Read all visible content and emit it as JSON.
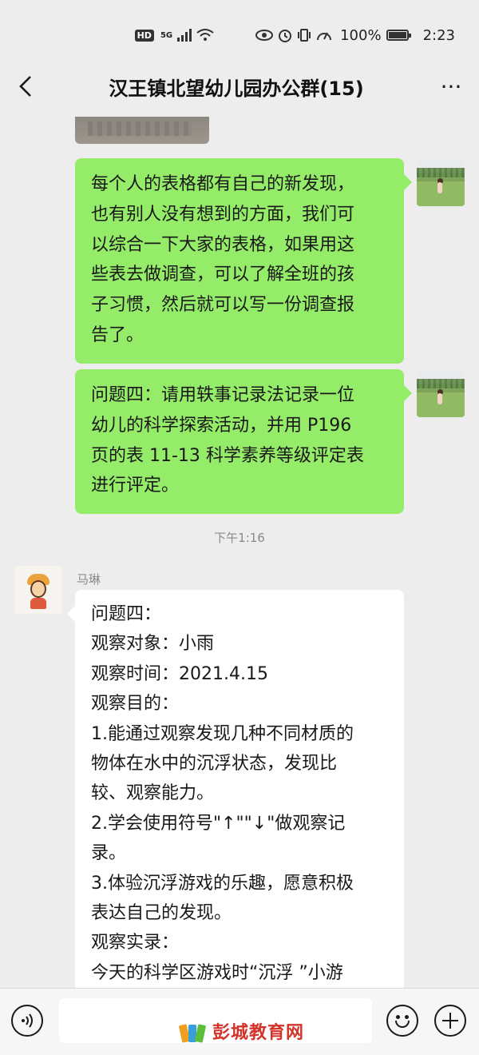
{
  "status_bar": {
    "hd": "HD",
    "network": "5G",
    "battery_pct": "100%",
    "battery_level": 1.0,
    "time": "2:23",
    "icons": [
      "signal-icon",
      "wifi-icon",
      "eye-icon",
      "alarm-icon",
      "vibrate-icon",
      "speed-icon",
      "battery-icon"
    ]
  },
  "nav": {
    "back_icon": "chevron-left-icon",
    "title": "汉王镇北望幼儿园办公群(15)",
    "more": "···"
  },
  "messages": [
    {
      "side": "right",
      "lines": [
        "每个人的表格都有自己的新发现，",
        "也有别人没有想到的方面，我们可",
        "以综合一下大家的表格，如果用这",
        "些表去做调查，可以了解全班的孩",
        "子习惯，然后就可以写一份调查报",
        "告了。"
      ]
    },
    {
      "side": "right",
      "lines": [
        "问题四：请用轶事记录法记录一位",
        "幼儿的科学探索活动，并用 P196",
        "页的表 11-13 科学素养等级评定表",
        "进行评定。"
      ]
    }
  ],
  "timestamp": "下午1:16",
  "incoming": {
    "sender": "马琳",
    "lines": [
      "问题四：",
      "观察对象：小雨",
      "观察时间：2021.4.15",
      "观察目的：",
      "1.能通过观察发现几种不同材质的",
      "物体在水中的沉浮状态，发现比",
      "较、观察能力。",
      "2.学会使用符号\"↑\"\"↓\"做观察记",
      "录。",
      "3.体验沉浮游戏的乐趣，愿意积极",
      "表达自己的发现。",
      "观察实录：",
      "今天的科学区游戏时“沉浮 ”小游"
    ]
  },
  "input_bar": {
    "voice_icon": "voice-icon",
    "emoji_icon": "emoji-icon",
    "plus_icon": "plus-icon"
  },
  "watermark": {
    "text": "彭城教育网",
    "color": "#d4332a"
  },
  "colors": {
    "bubble_sent": "#95ec69",
    "bubble_received": "#ffffff",
    "background": "#ededed"
  }
}
